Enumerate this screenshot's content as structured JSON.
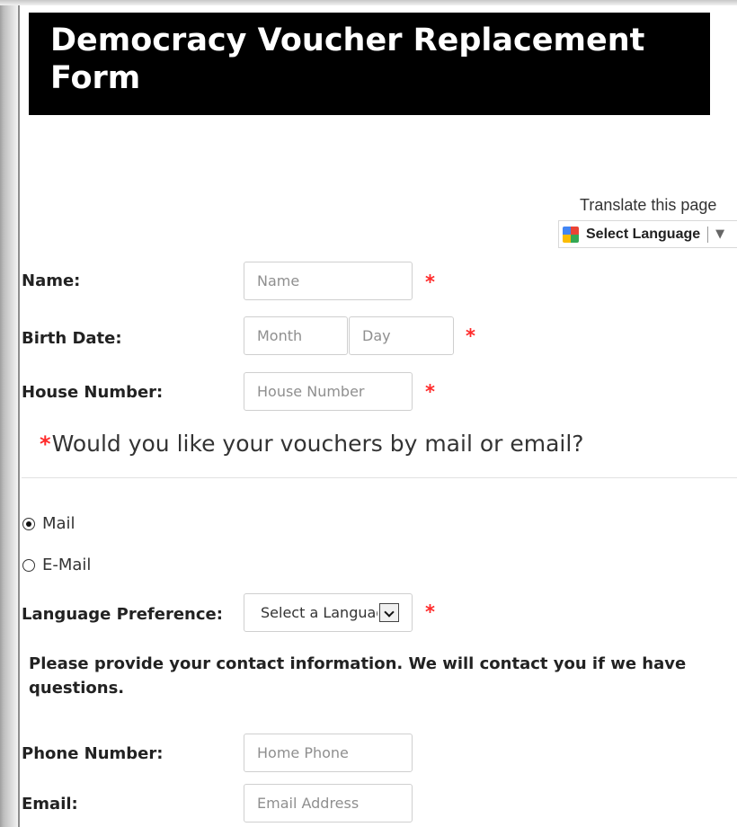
{
  "page": {
    "title": "Democracy Voucher Replacement Form"
  },
  "translate": {
    "label": "Translate this page",
    "select_label": "Select Language",
    "separator": "|",
    "arrow": "▼",
    "icon": "google-translate-icon"
  },
  "form": {
    "name": {
      "label": "Name:",
      "placeholder": "Name",
      "required_mark": "*"
    },
    "birth_date": {
      "label": "Birth Date:",
      "month_placeholder": "Month",
      "day_placeholder": "Day",
      "required_mark": "*"
    },
    "house_number": {
      "label": "House Number:",
      "placeholder": "House Number",
      "required_mark": "*"
    },
    "delivery": {
      "required_mark": "*",
      "question": "Would you like your vouchers by mail or email?",
      "options": [
        {
          "label": "Mail",
          "selected": true
        },
        {
          "label": "E-Mail",
          "selected": false
        }
      ]
    },
    "language_preference": {
      "label": "Language Preference:",
      "selected": "Select a Language",
      "required_mark": "*"
    },
    "contact_help": "Please provide your contact information. We will contact you if we have questions.",
    "phone_number": {
      "label": "Phone Number:",
      "placeholder": "Home Phone"
    },
    "email": {
      "label": "Email:",
      "placeholder": "Email Address"
    }
  },
  "colors": {
    "banner_background": "#000000",
    "banner_text": "#ffffff",
    "required": "#ff2a2a",
    "input_border": "#cfcfcf",
    "text": "#222222"
  }
}
